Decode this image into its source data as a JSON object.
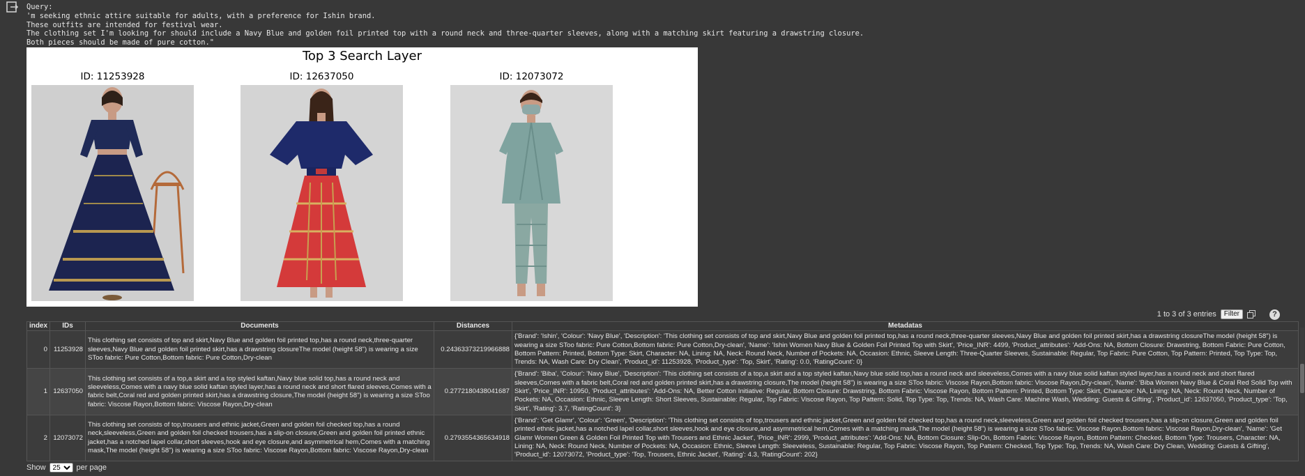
{
  "query": {
    "label": "Query:",
    "lines": [
      "'m seeking ethnic attire suitable for adults, with a preference for Ishin brand.",
      "These outfits are intended for festival wear.",
      "The clothing set I'm looking for should include a Navy Blue and golden foil printed top with a round neck and three-quarter sleeves, along with a matching skirt featuring a drawstring closure.",
      "Both pieces should be made of pure cotton.\""
    ]
  },
  "figure": {
    "title": "Top 3 Search Layer",
    "items": [
      {
        "caption": "ID: 11253928"
      },
      {
        "caption": "ID: 12637050"
      },
      {
        "caption": "ID: 12073072"
      }
    ]
  },
  "table_controls": {
    "entries_text": "1 to 3 of 3 entries",
    "filter_label": "Filter",
    "help_label": "?"
  },
  "table": {
    "columns": [
      "index",
      "IDs",
      "Documents",
      "Distances",
      "Metadatas"
    ],
    "rows": [
      {
        "index": "0",
        "id": "11253928",
        "document": "This clothing set consists of top and skirt,Navy Blue and golden foil printed top,has a round neck,three-quarter sleeves,Navy Blue and golden foil printed skirt,has a drawstring closureThe model (height 58\") is wearing a size SToo fabric: Pure Cotton,Bottom fabric: Pure Cotton,Dry-clean",
        "distance": "0.24363373219966888",
        "metadata": "{'Brand': 'Ishin', 'Colour': 'Navy Blue', 'Description': 'This clothing set consists of top and skirt,Navy Blue and golden foil printed top,has a round neck,three-quarter sleeves,Navy Blue and golden foil printed skirt,has a drawstring closureThe model (height 58\") is wearing a size SToo fabric: Pure Cotton,Bottom fabric: Pure Cotton,Dry-clean', 'Name': 'Ishin Women Navy Blue & Golden Foil Printed Top with Skirt', 'Price_INR': 4499, 'Product_attributes': 'Add-Ons: NA, Bottom Closure: Drawstring, Bottom Fabric: Pure Cotton, Bottom Pattern: Printed, Bottom Type: Skirt, Character: NA, Lining: NA, Neck: Round Neck, Number of Pockets: NA, Occasion: Ethnic, Sleeve Length: Three-Quarter Sleeves, Sustainable: Regular, Top Fabric: Pure Cotton, Top Pattern: Printed, Top Type: Top, Trends: NA, Wash Care: Dry Clean', 'Product_id': 11253928, 'Product_type': 'Top, Skirt', 'Rating': 0.0, 'RatingCount': 0}"
      },
      {
        "index": "1",
        "id": "12637050",
        "document": "This clothing set consists of a top,a skirt and a top styled kaftan,Navy blue solid top,has a round neck and sleeveless,Comes with a navy blue solid kaftan styled layer,has a round neck and short flared sleeves,Comes with a fabric belt,Coral red and golden printed skirt,has a drawstring closure,The model (height 58\") is wearing a size SToo fabric: Viscose Rayon,Bottom fabric: Viscose Rayon,Dry-clean",
        "distance": "0.2772180438041687",
        "metadata": "{'Brand': 'Biba', 'Colour': 'Navy Blue', 'Description': 'This clothing set consists of a top,a skirt and a top styled kaftan,Navy blue solid top,has a round neck and sleeveless,Comes with a navy blue solid kaftan styled layer,has a round neck and short flared sleeves,Comes with a fabric belt,Coral red and golden printed skirt,has a drawstring closure,The model (height 58\") is wearing a size SToo fabric: Viscose Rayon,Bottom fabric: Viscose Rayon,Dry-clean', 'Name': 'Biba Women Navy Blue & Coral Red Solid Top with Skirt', 'Price_INR': 10950, 'Product_attributes': 'Add-Ons: NA, Better Cotton Initiative: Regular, Bottom Closure: Drawstring, Bottom Fabric: Viscose Rayon, Bottom Pattern: Printed, Bottom Type: Skirt, Character: NA, Lining: NA, Neck: Round Neck, Number of Pockets: NA, Occasion: Ethnic, Sleeve Length: Short Sleeves, Sustainable: Regular, Top Fabric: Viscose Rayon, Top Pattern: Solid, Top Type: Top, Trends: NA, Wash Care: Machine Wash, Wedding: Guests & Gifting', 'Product_id': 12637050, 'Product_type': 'Top, Skirt', 'Rating': 3.7, 'RatingCount': 3}"
      },
      {
        "index": "2",
        "id": "12073072",
        "document": "This clothing set consists of top,trousers and ethnic jacket,Green and golden foil checked top,has a round neck,sleeveless,Green and golden foil checked trousers,has a slip-on closure,Green and golden foil printed ethnic jacket,has a notched lapel collar,short sleeves,hook and eye closure,and asymmetrical hem,Comes with a matching mask,The model (height 58\") is wearing a size SToo fabric: Viscose Rayon,Bottom fabric: Viscose Rayon,Dry-clean",
        "distance": "0.2793554365634918",
        "metadata": "{'Brand': 'Get Glamr', 'Colour': 'Green', 'Description': 'This clothing set consists of top,trousers and ethnic jacket,Green and golden foil checked top,has a round neck,sleeveless,Green and golden foil checked trousers,has a slip-on closure,Green and golden foil printed ethnic jacket,has a notched lapel collar,short sleeves,hook and eye closure,and asymmetrical hem,Comes with a matching mask,The model (height 58\") is wearing a size SToo fabric: Viscose Rayon,Bottom fabric: Viscose Rayon,Dry-clean', 'Name': 'Get Glamr Women Green & Golden Foil Printed Top with Trousers and Ethnic Jacket', 'Price_INR': 2999, 'Product_attributes': 'Add-Ons: NA, Bottom Closure: Slip-On, Bottom Fabric: Viscose Rayon, Bottom Pattern: Checked, Bottom Type: Trousers, Character: NA, Lining: NA, Neck: Round Neck, Number of Pockets: NA, Occasion: Ethnic, Sleeve Length: Sleeveless, Sustainable: Regular, Top Fabric: Viscose Rayon, Top Pattern: Checked, Top Type: Top, Trends: NA, Wash Care: Dry Clean, Wedding: Guests & Gifting', 'Product_id': 12073072, 'Product_type': 'Top, Trousers, Ethnic Jacket', 'Rating': 4.3, 'RatingCount': 202}"
      }
    ]
  },
  "pagination": {
    "show_label": "Show",
    "page_size": "25",
    "per_page_label": "per page"
  },
  "colors": {
    "background": "#383838",
    "figure_background": "#ffffff",
    "row_alt": "#454545"
  }
}
